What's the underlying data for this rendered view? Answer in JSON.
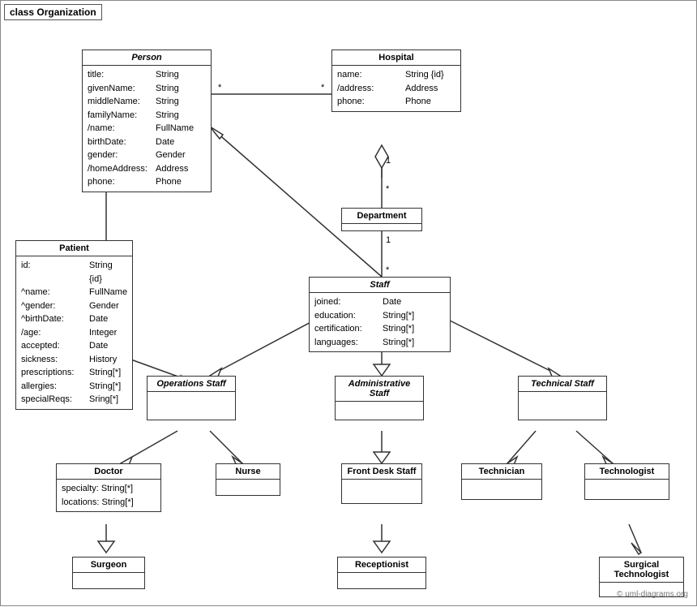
{
  "diagram": {
    "title": "class Organization",
    "watermark": "© uml-diagrams.org",
    "classes": {
      "person": {
        "title": "Person",
        "italic": true,
        "attrs": [
          {
            "name": "title:",
            "type": "String"
          },
          {
            "name": "givenName:",
            "type": "String"
          },
          {
            "name": "middleName:",
            "type": "String"
          },
          {
            "name": "familyName:",
            "type": "String"
          },
          {
            "name": "/name:",
            "type": "FullName"
          },
          {
            "name": "birthDate:",
            "type": "Date"
          },
          {
            "name": "gender:",
            "type": "Gender"
          },
          {
            "name": "/homeAddress:",
            "type": "Address"
          },
          {
            "name": "phone:",
            "type": "Phone"
          }
        ]
      },
      "hospital": {
        "title": "Hospital",
        "italic": false,
        "attrs": [
          {
            "name": "name:",
            "type": "String {id}"
          },
          {
            "name": "/address:",
            "type": "Address"
          },
          {
            "name": "phone:",
            "type": "Phone"
          }
        ]
      },
      "department": {
        "title": "Department",
        "italic": false,
        "attrs": []
      },
      "patient": {
        "title": "Patient",
        "italic": false,
        "attrs": [
          {
            "name": "id:",
            "type": "String {id}"
          },
          {
            "name": "^name:",
            "type": "FullName"
          },
          {
            "name": "^gender:",
            "type": "Gender"
          },
          {
            "name": "^birthDate:",
            "type": "Date"
          },
          {
            "name": "/age:",
            "type": "Integer"
          },
          {
            "name": "accepted:",
            "type": "Date"
          },
          {
            "name": "sickness:",
            "type": "History"
          },
          {
            "name": "prescriptions:",
            "type": "String[*]"
          },
          {
            "name": "allergies:",
            "type": "String[*]"
          },
          {
            "name": "specialReqs:",
            "type": "Sring[*]"
          }
        ]
      },
      "staff": {
        "title": "Staff",
        "italic": true,
        "attrs": [
          {
            "name": "joined:",
            "type": "Date"
          },
          {
            "name": "education:",
            "type": "String[*]"
          },
          {
            "name": "certification:",
            "type": "String[*]"
          },
          {
            "name": "languages:",
            "type": "String[*]"
          }
        ]
      },
      "operations_staff": {
        "title": "Operations Staff",
        "italic": true
      },
      "administrative_staff": {
        "title": "Administrative Staff",
        "italic": true
      },
      "technical_staff": {
        "title": "Technical Staff",
        "italic": true
      },
      "doctor": {
        "title": "Doctor",
        "italic": false,
        "attrs": [
          {
            "name": "specialty:",
            "type": "String[*]"
          },
          {
            "name": "locations:",
            "type": "String[*]"
          }
        ]
      },
      "nurse": {
        "title": "Nurse",
        "italic": false
      },
      "front_desk_staff": {
        "title": "Front Desk Staff",
        "italic": false
      },
      "technician": {
        "title": "Technician",
        "italic": false
      },
      "technologist": {
        "title": "Technologist",
        "italic": false
      },
      "surgeon": {
        "title": "Surgeon",
        "italic": false
      },
      "receptionist": {
        "title": "Receptionist",
        "italic": false
      },
      "surgical_technologist": {
        "title": "Surgical Technologist",
        "italic": false
      }
    }
  }
}
